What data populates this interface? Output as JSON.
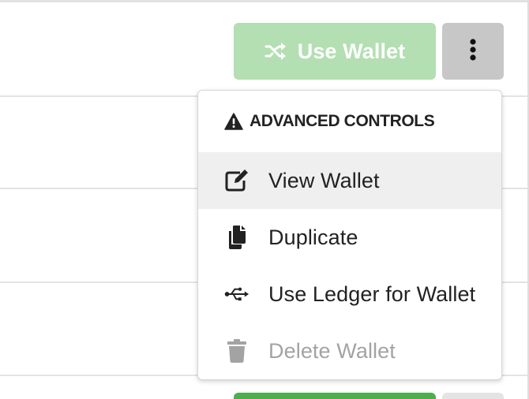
{
  "toolbar": {
    "use_wallet_label": "Use Wallet",
    "use_wallet_icon": "random-shuffle-icon",
    "more_icon": "vertical-ellipsis-icon"
  },
  "dropdown": {
    "header": "ADVANCED CONTROLS",
    "header_icon": "warning-triangle-icon",
    "items": [
      {
        "label": "View Wallet",
        "icon": "edit-icon",
        "highlighted": true,
        "disabled": false
      },
      {
        "label": "Duplicate",
        "icon": "copy-icon",
        "highlighted": false,
        "disabled": false
      },
      {
        "label": "Use Ledger for Wallet",
        "icon": "usb-icon",
        "highlighted": false,
        "disabled": false
      },
      {
        "label": "Delete Wallet",
        "icon": "trash-icon",
        "highlighted": false,
        "disabled": true
      }
    ]
  },
  "colors": {
    "use_wallet_bg": "#b3dfb2",
    "more_bg": "#c7c7c7",
    "highlight_bg": "#efefef",
    "disabled_text": "#a3a3a3",
    "bottom_green": "#4cae4c"
  }
}
